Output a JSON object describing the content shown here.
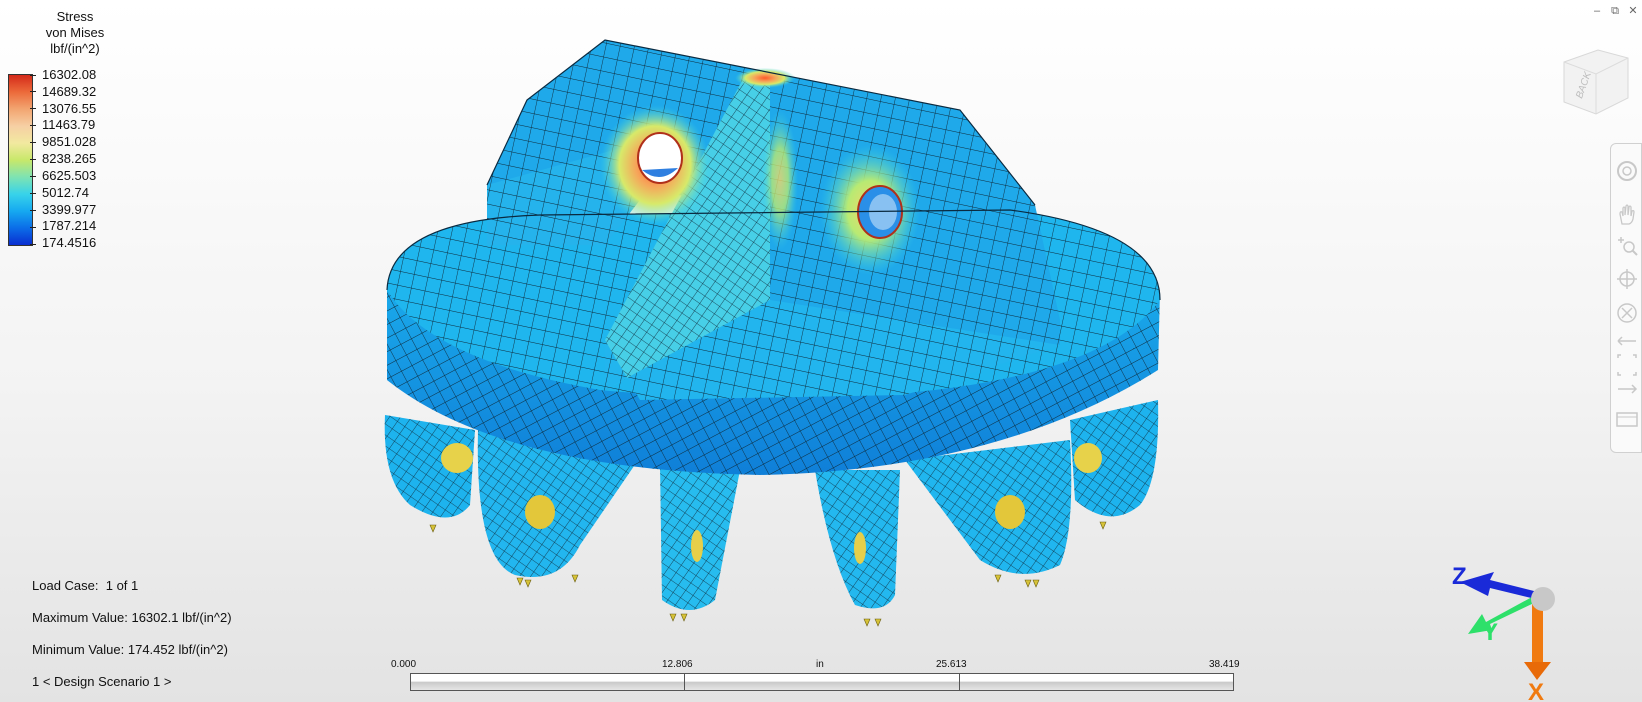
{
  "legend": {
    "title_lines": [
      "Stress",
      "von Mises",
      "lbf/(in^2)"
    ],
    "values": [
      "16302.08",
      "14689.32",
      "13076.55",
      "11463.79",
      "9851.028",
      "8238.265",
      "6625.503",
      "5012.74",
      "3399.977",
      "1787.214",
      "174.4516"
    ]
  },
  "info": {
    "load_case_label": "Load Case:",
    "load_case_value": "1 of 1",
    "max_label": "Maximum Value:",
    "max_value": "16302.1 lbf/(in^2)",
    "min_label": "Minimum Value:",
    "min_value": "174.452 lbf/(in^2)",
    "scenario": "1 < Design Scenario 1 >"
  },
  "ruler": {
    "labels": [
      "0.000",
      "12.806",
      "25.613",
      "38.419"
    ],
    "unit": "in"
  },
  "viewcube": {
    "face_label": "BACK"
  },
  "triad": {
    "z": "Z",
    "y": "Y",
    "x": "X"
  },
  "colors": {
    "triad_z": "#1a2ad8",
    "triad_y": "#2ee06a",
    "triad_x": "#f07a10",
    "mesh_base": "#1fb8ee",
    "mesh_lines": "#111111",
    "hotspot": "#f2823a"
  },
  "nav_icons": [
    "steeringwheel-icon",
    "pan-icon",
    "zoom-icon",
    "orbit-icon",
    "center-icon",
    "look-icon",
    "walk-icon",
    "fit-icon",
    "showmotion-icon"
  ]
}
